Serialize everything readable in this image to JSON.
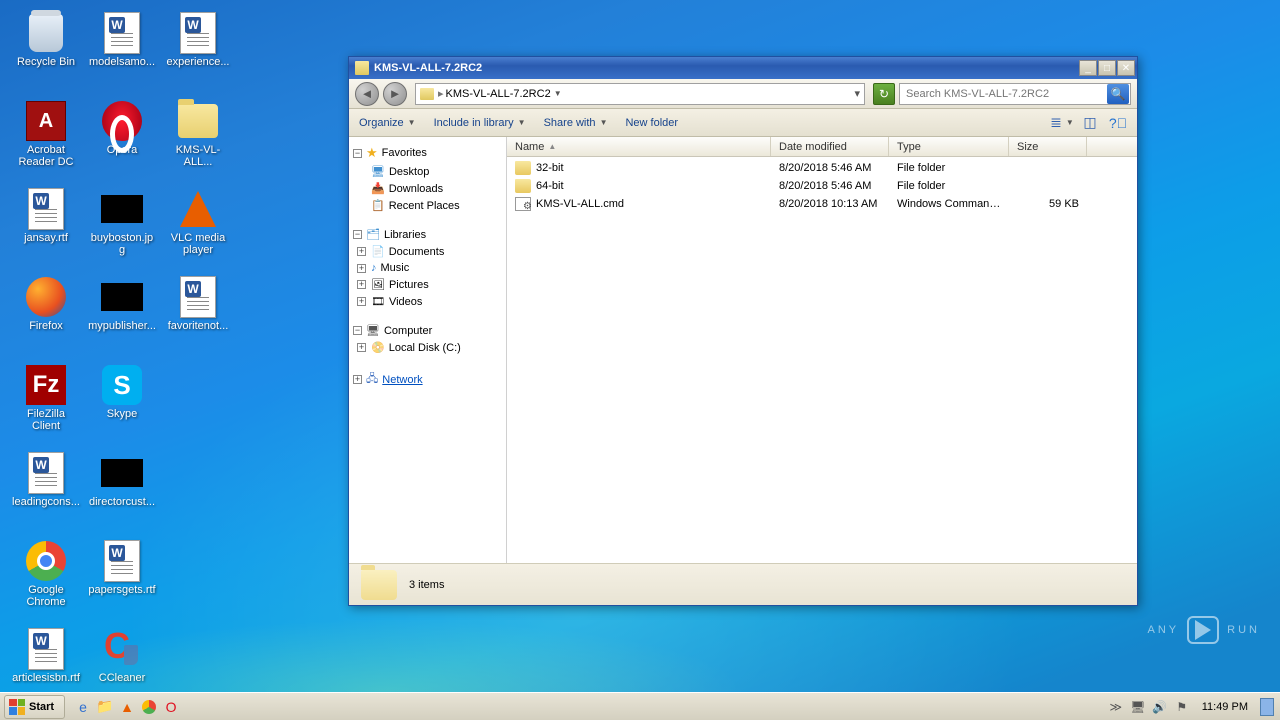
{
  "desktop_icons": [
    {
      "label": "Recycle Bin",
      "kind": "bin"
    },
    {
      "label": "Acrobat Reader DC",
      "kind": "adobe"
    },
    {
      "label": "jansay.rtf",
      "kind": "word"
    },
    {
      "label": "Firefox",
      "kind": "ff"
    },
    {
      "label": "FileZilla Client",
      "kind": "fz"
    },
    {
      "label": "leadingcons...",
      "kind": "word"
    },
    {
      "label": "Google Chrome",
      "kind": "chrome"
    },
    {
      "label": "articlesisbn.rtf",
      "kind": "word"
    },
    {
      "label": "modelsamo...",
      "kind": "word"
    },
    {
      "label": "Opera",
      "kind": "opera"
    },
    {
      "label": "buyboston.jpg",
      "kind": "jpg"
    },
    {
      "label": "mypublisher...",
      "kind": "jpg"
    },
    {
      "label": "Skype",
      "kind": "skype"
    },
    {
      "label": "directorcust...",
      "kind": "jpg"
    },
    {
      "label": "papersgets.rtf",
      "kind": "word"
    },
    {
      "label": "CCleaner",
      "kind": "cc"
    },
    {
      "label": "experience...",
      "kind": "word"
    },
    {
      "label": "KMS-VL-ALL...",
      "kind": "folder-big"
    },
    {
      "label": "VLC media player",
      "kind": "vlc"
    },
    {
      "label": "favoritenot...",
      "kind": "word"
    }
  ],
  "window": {
    "title": "KMS-VL-ALL-7.2RC2",
    "breadcrumb": "KMS-VL-ALL-7.2RC2",
    "search_placeholder": "Search KMS-VL-ALL-7.2RC2",
    "toolbar": {
      "organize": "Organize",
      "include": "Include in library",
      "share": "Share with",
      "newfolder": "New folder"
    },
    "sidebar": {
      "favorites": {
        "head": "Favorites",
        "items": [
          "Desktop",
          "Downloads",
          "Recent Places"
        ]
      },
      "libraries": {
        "head": "Libraries",
        "items": [
          "Documents",
          "Music",
          "Pictures",
          "Videos"
        ]
      },
      "computer": {
        "head": "Computer",
        "items": [
          "Local Disk (C:)"
        ]
      },
      "network": {
        "head": "Network"
      }
    },
    "columns": {
      "name": "Name",
      "modified": "Date modified",
      "type": "Type",
      "size": "Size"
    },
    "files": [
      {
        "name": "32-bit",
        "modified": "8/20/2018 5:46 AM",
        "type": "File folder",
        "size": "",
        "icon": "folder"
      },
      {
        "name": "64-bit",
        "modified": "8/20/2018 5:46 AM",
        "type": "File folder",
        "size": "",
        "icon": "folder"
      },
      {
        "name": "KMS-VL-ALL.cmd",
        "modified": "8/20/2018 10:13 AM",
        "type": "Windows Command ...",
        "size": "59 KB",
        "icon": "cmd"
      }
    ],
    "status": "3 items"
  },
  "taskbar": {
    "start": "Start",
    "clock": "11:49 PM"
  },
  "watermark": {
    "brand": "ANY",
    "suffix": "RUN"
  }
}
